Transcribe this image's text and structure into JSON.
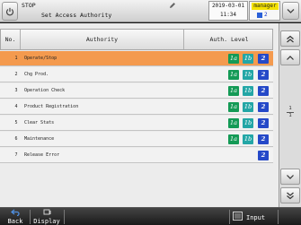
{
  "header": {
    "status": "STOP",
    "title": "Set Access Authority",
    "date": "2019-03-01",
    "time": "11:34",
    "user": "manager",
    "user_level": "2"
  },
  "table": {
    "columns": {
      "no": "No.",
      "authority": "Authority",
      "level": "Auth. Level"
    },
    "rows": [
      {
        "no": "1",
        "name": "Operate/Stop",
        "levels": [
          "1a",
          "1b",
          "2"
        ],
        "selected": true
      },
      {
        "no": "2",
        "name": "Chg Prod.",
        "levels": [
          "1a",
          "1b",
          "2"
        ],
        "selected": false
      },
      {
        "no": "3",
        "name": "Operation Check",
        "levels": [
          "1a",
          "1b",
          "2"
        ],
        "selected": false
      },
      {
        "no": "4",
        "name": "Product Registration",
        "levels": [
          "1a",
          "1b",
          "2"
        ],
        "selected": false
      },
      {
        "no": "5",
        "name": "Clear Stats",
        "levels": [
          "1a",
          "1b",
          "2"
        ],
        "selected": false
      },
      {
        "no": "6",
        "name": "Maintenance",
        "levels": [
          "1a",
          "1b",
          "2"
        ],
        "selected": false
      },
      {
        "no": "7",
        "name": "Release Error",
        "levels": [
          "2"
        ],
        "selected": false
      }
    ]
  },
  "pager": {
    "current": "1",
    "total": "1"
  },
  "footer": {
    "back": "Back",
    "display": "Display",
    "input": "Input"
  },
  "colors": {
    "selected_row": "#f49a4e",
    "level_1a": "#149a56",
    "level_1b": "#23a6a6",
    "level_2": "#2549c8",
    "user_tag": "#f4e200"
  }
}
